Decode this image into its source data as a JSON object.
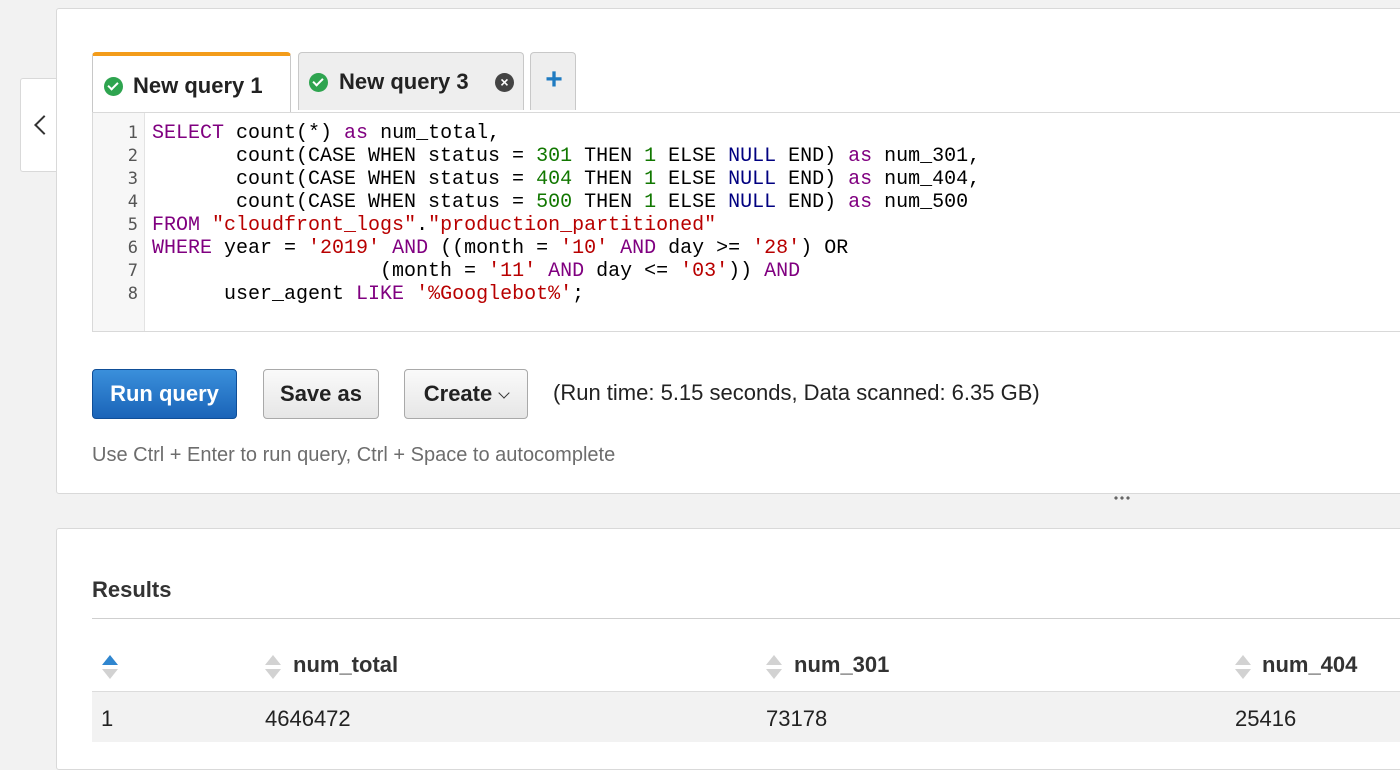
{
  "tabs": [
    {
      "label": "New query 1",
      "status_icon": "check-circle-icon",
      "active": true
    },
    {
      "label": "New query 3",
      "status_icon": "check-circle-icon",
      "active": false,
      "closable": true
    },
    {
      "label": "+",
      "icon": "plus-icon"
    }
  ],
  "editor": {
    "line_numbers": [
      "1",
      "2",
      "3",
      "4",
      "5",
      "6",
      "7",
      "8"
    ],
    "lines": [
      [
        {
          "t": "SELECT",
          "c": "kw"
        },
        {
          "t": " count(*) "
        },
        {
          "t": "as",
          "c": "kw"
        },
        {
          "t": " num_total,"
        }
      ],
      [
        {
          "t": "       count(CASE WHEN status = "
        },
        {
          "t": "301",
          "c": "num"
        },
        {
          "t": " THEN "
        },
        {
          "t": "1",
          "c": "num"
        },
        {
          "t": " ELSE "
        },
        {
          "t": "NULL",
          "c": "nul"
        },
        {
          "t": " END) "
        },
        {
          "t": "as",
          "c": "kw"
        },
        {
          "t": " num_301,"
        }
      ],
      [
        {
          "t": "       count(CASE WHEN status = "
        },
        {
          "t": "404",
          "c": "num"
        },
        {
          "t": " THEN "
        },
        {
          "t": "1",
          "c": "num"
        },
        {
          "t": " ELSE "
        },
        {
          "t": "NULL",
          "c": "nul"
        },
        {
          "t": " END) "
        },
        {
          "t": "as",
          "c": "kw"
        },
        {
          "t": " num_404,"
        }
      ],
      [
        {
          "t": "       count(CASE WHEN status = "
        },
        {
          "t": "500",
          "c": "num"
        },
        {
          "t": " THEN "
        },
        {
          "t": "1",
          "c": "num"
        },
        {
          "t": " ELSE "
        },
        {
          "t": "NULL",
          "c": "nul"
        },
        {
          "t": " END) "
        },
        {
          "t": "as",
          "c": "kw"
        },
        {
          "t": " num_500"
        }
      ],
      [
        {
          "t": "FROM",
          "c": "kw"
        },
        {
          "t": " "
        },
        {
          "t": "\"cloudfront_logs\"",
          "c": "str"
        },
        {
          "t": "."
        },
        {
          "t": "\"production_partitioned\"",
          "c": "str"
        }
      ],
      [
        {
          "t": "WHERE",
          "c": "kw"
        },
        {
          "t": " year = "
        },
        {
          "t": "'2019'",
          "c": "str"
        },
        {
          "t": " "
        },
        {
          "t": "AND",
          "c": "kw"
        },
        {
          "t": " ((month = "
        },
        {
          "t": "'10'",
          "c": "str"
        },
        {
          "t": " "
        },
        {
          "t": "AND",
          "c": "kw"
        },
        {
          "t": " day >= "
        },
        {
          "t": "'28'",
          "c": "str"
        },
        {
          "t": ") OR"
        }
      ],
      [
        {
          "t": "                   (month = "
        },
        {
          "t": "'11'",
          "c": "str"
        },
        {
          "t": " "
        },
        {
          "t": "AND",
          "c": "kw"
        },
        {
          "t": " day <= "
        },
        {
          "t": "'03'",
          "c": "str"
        },
        {
          "t": ")) "
        },
        {
          "t": "AND",
          "c": "kw"
        }
      ],
      [
        {
          "t": "      user_agent "
        },
        {
          "t": "LIKE",
          "c": "kw"
        },
        {
          "t": " "
        },
        {
          "t": "'%Googlebot%'",
          "c": "str"
        },
        {
          "t": ";"
        }
      ]
    ]
  },
  "actions": {
    "run_label": "Run query",
    "save_label": "Save as",
    "create_label": "Create"
  },
  "run_info": "(Run time: 5.15 seconds, Data scanned: 6.35 GB)",
  "hint": "Use Ctrl + Enter to run query, Ctrl + Space to autocomplete",
  "results": {
    "title": "Results",
    "columns": [
      "",
      "num_total",
      "num_301",
      "num_404"
    ],
    "rows": [
      [
        "1",
        "4646472",
        "73178",
        "25416"
      ]
    ]
  },
  "colors": {
    "active_tab_accent": "#f39c1a",
    "primary_button": "#1f6fc5",
    "success": "#2ea44f",
    "keyword": "#800080",
    "string": "#b80000",
    "number": "#117700",
    "null": "#000080"
  }
}
